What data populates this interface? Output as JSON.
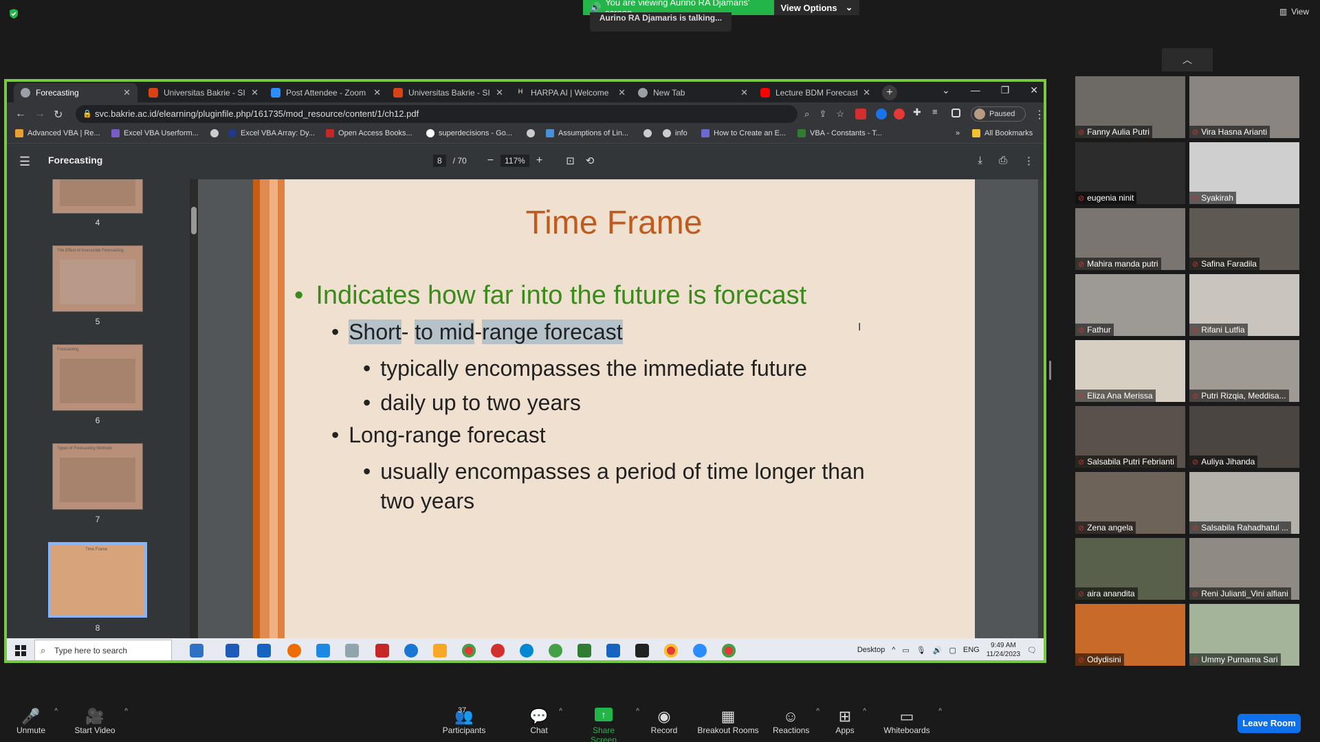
{
  "zoom": {
    "viewing_banner": "You are viewing Aurino RA Djamaris' screen",
    "view_options": "View Options",
    "talking": "Aurino RA Djamaris is talking...",
    "view": "View",
    "leave": "Leave Room"
  },
  "browser": {
    "tabs": [
      {
        "label": "Forecasting",
        "color": "#9aa0a6"
      },
      {
        "label": "Universitas Bakrie - SIM",
        "color": "#d84315"
      },
      {
        "label": "Post Attendee - Zoom",
        "color": "#2d8cff"
      },
      {
        "label": "Universitas Bakrie - SIM",
        "color": "#d84315"
      },
      {
        "label": "HARPA AI | Welcome",
        "color": "#222222"
      },
      {
        "label": "New Tab",
        "color": "#9aa0a6"
      },
      {
        "label": "Lecture BDM Forecastin",
        "color": "#ff0000"
      }
    ],
    "url": "svc.bakrie.ac.id/elearning/pluginfile.php/161735/mod_resource/content/1/ch12.pdf",
    "profile_status": "Paused",
    "bookmarks": [
      "Advanced VBA | Re...",
      "Excel VBA Userform...",
      "",
      "Excel VBA Array: Dy...",
      "Open Access Books...",
      "superdecisions - Go...",
      "",
      "Assumptions of Lin...",
      "",
      "info",
      "How to Create an E...",
      "VBA - Constants - T..."
    ],
    "all_bookmarks": "All Bookmarks"
  },
  "pdf": {
    "title": "Forecasting",
    "page": "8",
    "total": "/ 70",
    "zoom": "117%",
    "thumb_numbers": [
      "4",
      "5",
      "6",
      "7",
      "8"
    ],
    "thumb_titles": [
      "",
      "The Effect of Inaccurate Forecasting",
      "Forecasting",
      "Types of Forecasting Methods",
      "Time Frame"
    ],
    "slide": {
      "title": "Time Frame",
      "bullet1": "Indicates how far into the future is forecast",
      "sub1_a": "Short",
      "sub1_b": "- ",
      "sub1_c": "to mid",
      "sub1_d": "-",
      "sub1_e": "range forecast",
      "sub1_1": "typically encompasses the immediate future",
      "sub1_2": "daily up to two years",
      "sub2": "Long-range forecast",
      "sub2_1a": "usually encompasses a period of time longer than",
      "sub2_1b": "two years"
    }
  },
  "taskbar": {
    "search": "Type here to search",
    "desktop": "Desktop",
    "lang": "ENG",
    "time": "9:49 AM",
    "date": "11/24/2023"
  },
  "participants": [
    "Fanny Aulia Putri",
    "Vira Hasna Arianti",
    "eugenia ninit",
    "Syakirah",
    "Mahira manda putri",
    "Safina Faradila",
    "Fathur",
    "Rifani Lutfia",
    "Eliza Ana Merissa",
    "Putri Rizqia, Meddisa...",
    "Salsabila Putri Febrianti",
    "Auliya Jihanda",
    "Zena angela",
    "Salsabila Rahadhatul ...",
    "aira anandita",
    "Reni Julianti_Vini alfiani",
    "Odydisini",
    "Ummy Purnama Sari"
  ],
  "toolbar": {
    "unmute": "Unmute",
    "start_video": "Start Video",
    "participants": "Participants",
    "participants_count": "37",
    "chat": "Chat",
    "share": "Share Screen",
    "record": "Record",
    "breakout": "Breakout Rooms",
    "reactions": "Reactions",
    "apps": "Apps",
    "whiteboards": "Whiteboards"
  },
  "colors": {
    "share_green": "#24b548",
    "leave_blue": "#0e71eb",
    "slide_title": "#c15a1d",
    "slide_bullet": "#3a8a1c"
  }
}
